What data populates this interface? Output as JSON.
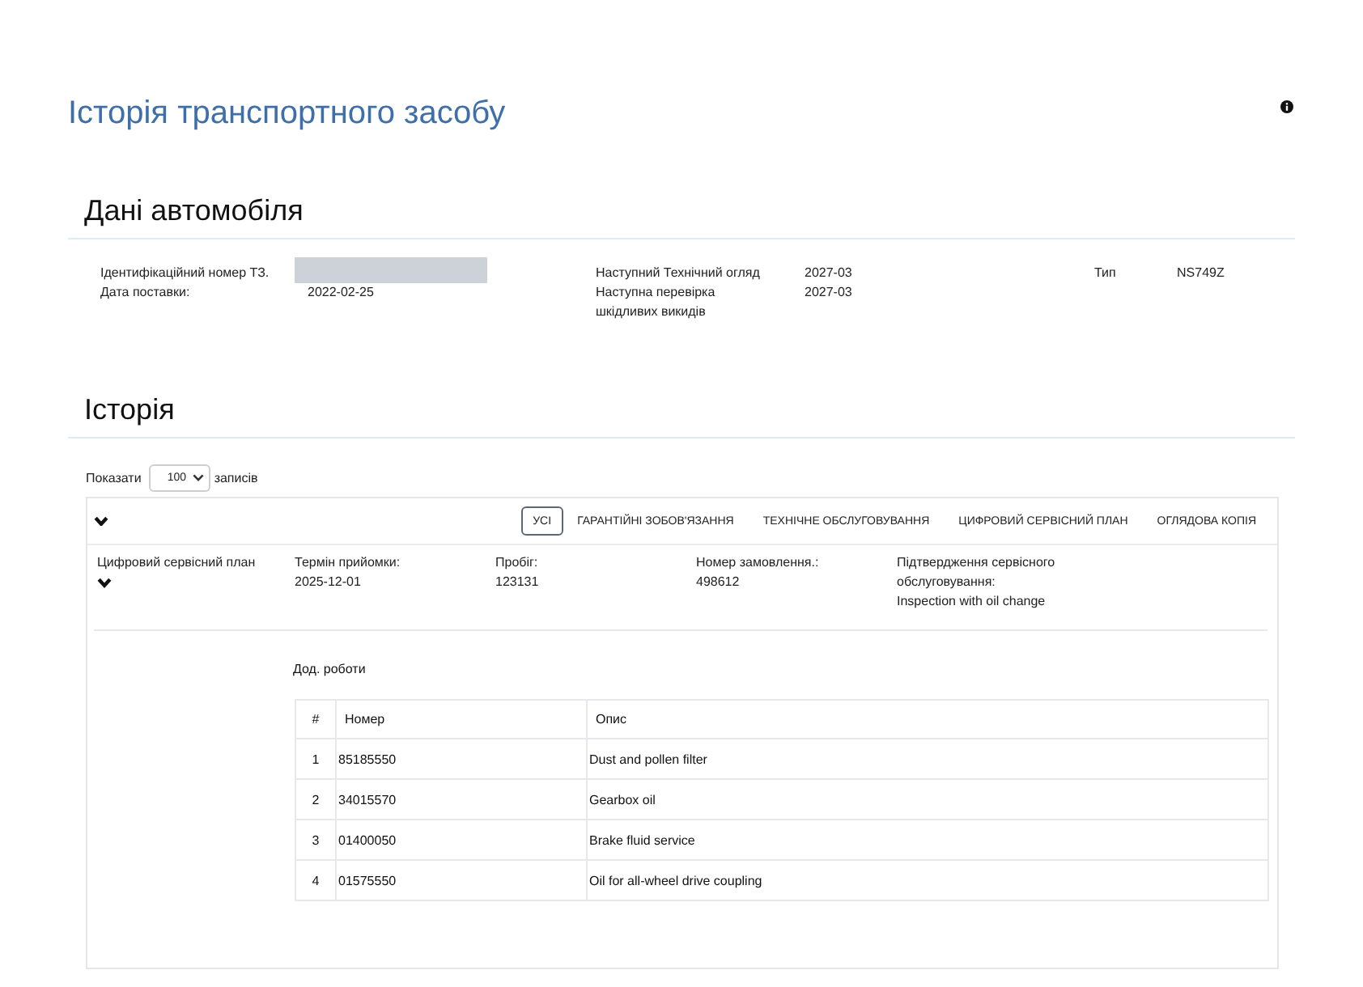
{
  "header": {
    "title": "Історія транспортного засобу"
  },
  "vehicle": {
    "heading": "Дані автомобіля",
    "columns": [
      [
        {
          "label": "Ідентифікаційний номер ТЗ.",
          "redacted": true
        },
        {
          "label": "Дата поставки:",
          "value": "2022-02-25",
          "redacted": false
        }
      ],
      [
        {
          "label": "Наступний Технічний огляд",
          "value": "2027-03",
          "redacted": false
        },
        {
          "label": "Наступна перевірка шкідливих викидів",
          "value": "2027-03",
          "redacted": false
        }
      ],
      [
        {
          "label": "Тип",
          "value": "NS749Z",
          "redacted": false
        }
      ]
    ]
  },
  "history": {
    "heading": "Історія",
    "page_length": {
      "label": "Показати",
      "value": "100",
      "suffix": "записів"
    },
    "filters": [
      {
        "label": "УСІ",
        "selected": true
      },
      {
        "label": "ГАРАНТІЙНІ ЗОБОВ'ЯЗАННЯ",
        "selected": false
      },
      {
        "label": "ТЕХНІЧНЕ ОБСЛУГОВУВАННЯ",
        "selected": false
      },
      {
        "label": "ЦИФРОВИЙ СЕРВІСНИЙ ПЛАН",
        "selected": false
      },
      {
        "label": "ОГЛЯДОВА КОПІЯ",
        "selected": false
      }
    ],
    "records": [
      {
        "type": "Цифровий сервісний план",
        "fields": [
          {
            "label": "Термін прийомки:",
            "value": "2025-12-01"
          },
          {
            "label": "Пробіг:",
            "value": "123131"
          },
          {
            "label": "Номер замовлення.:",
            "value": "498612"
          },
          {
            "label": "Підтвердження сервісного обслуговування:",
            "value": "Inspection with oil change"
          }
        ],
        "extra_work": {
          "title": "Дод. роботи",
          "columns": [
            "#",
            "Номер",
            "Опис"
          ],
          "rows": [
            [
              "1",
              "85185550",
              "Dust and pollen filter"
            ],
            [
              "2",
              "34015570",
              "Gearbox oil"
            ],
            [
              "3",
              "01400050",
              "Brake fluid service"
            ],
            [
              "4",
              "01575550",
              "Oil for all-wheel drive coupling"
            ]
          ]
        }
      }
    ]
  }
}
